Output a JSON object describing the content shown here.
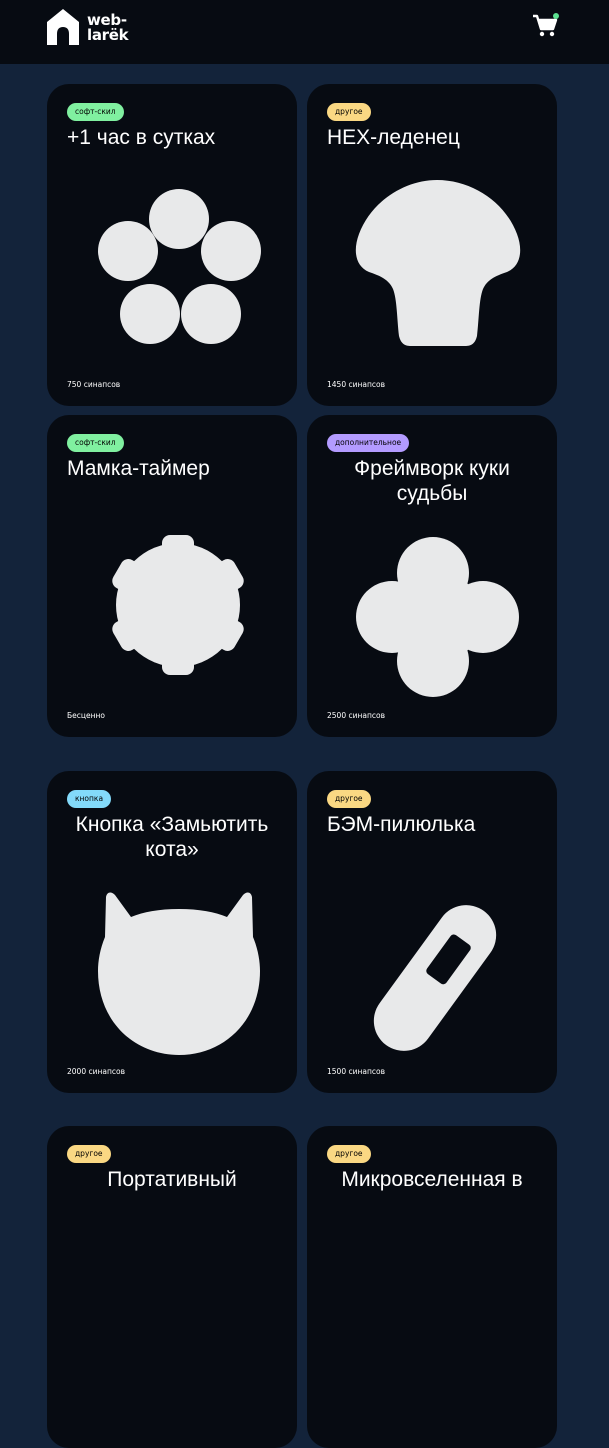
{
  "header": {
    "logo_line1": "web-",
    "logo_line2": "larёk",
    "logo_icon": "house-icon",
    "cart_icon": "cart-icon"
  },
  "colors": {
    "background": "#13233a",
    "header": "#070b12",
    "card": "#070b12",
    "tag_soft": "#80f0a0",
    "tag_other": "#fad883",
    "tag_additional": "#b39bff",
    "tag_button": "#83dafa",
    "cart_badge": "#5de291",
    "image_fill": "#e8e9ea"
  },
  "products": [
    {
      "category": "софт-скил",
      "title": "+1 час в сутках",
      "price": "750 синапсов",
      "image": "five-circles"
    },
    {
      "category": "другое",
      "title": "HEX-леденец",
      "price": "1450 синапсов",
      "image": "shell"
    },
    {
      "category": "софт-скил",
      "title": "Мамка-таймер",
      "price": "Бесценно",
      "image": "gear"
    },
    {
      "category": "дополнительное",
      "title": "Фреймворк куки судьбы",
      "price": "2500 синапсов",
      "image": "flower"
    },
    {
      "category": "кнопка",
      "title": "Кнопка «Замьютить кота»",
      "price": "2000 синапсов",
      "image": "cat-head"
    },
    {
      "category": "другое",
      "title": "БЭМ-пилюлька",
      "price": "1500 синапсов",
      "image": "pill"
    },
    {
      "category": "другое",
      "title": "Портативный",
      "price": "",
      "image": ""
    },
    {
      "category": "другое",
      "title": "Микровселенная в",
      "price": "",
      "image": ""
    }
  ]
}
